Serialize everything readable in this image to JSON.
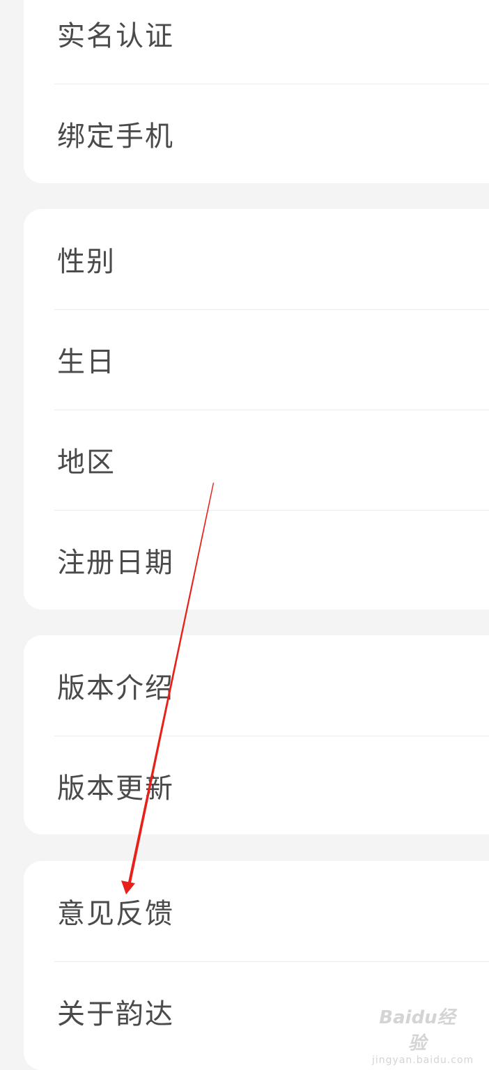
{
  "sections": [
    {
      "items": [
        {
          "label": "实名认证"
        },
        {
          "label": "绑定手机"
        }
      ]
    },
    {
      "items": [
        {
          "label": "性别"
        },
        {
          "label": "生日"
        },
        {
          "label": "地区"
        },
        {
          "label": "注册日期"
        }
      ]
    },
    {
      "items": [
        {
          "label": "版本介绍"
        },
        {
          "label": "版本更新"
        }
      ]
    },
    {
      "items": [
        {
          "label": "意见反馈"
        },
        {
          "label": "关于韵达"
        }
      ]
    }
  ],
  "annotation": {
    "color": "#e8201a",
    "icon": "arrow-annotation-icon"
  },
  "watermark": {
    "logo": "Baidu经验",
    "sub": "jingyan.baidu.com"
  }
}
